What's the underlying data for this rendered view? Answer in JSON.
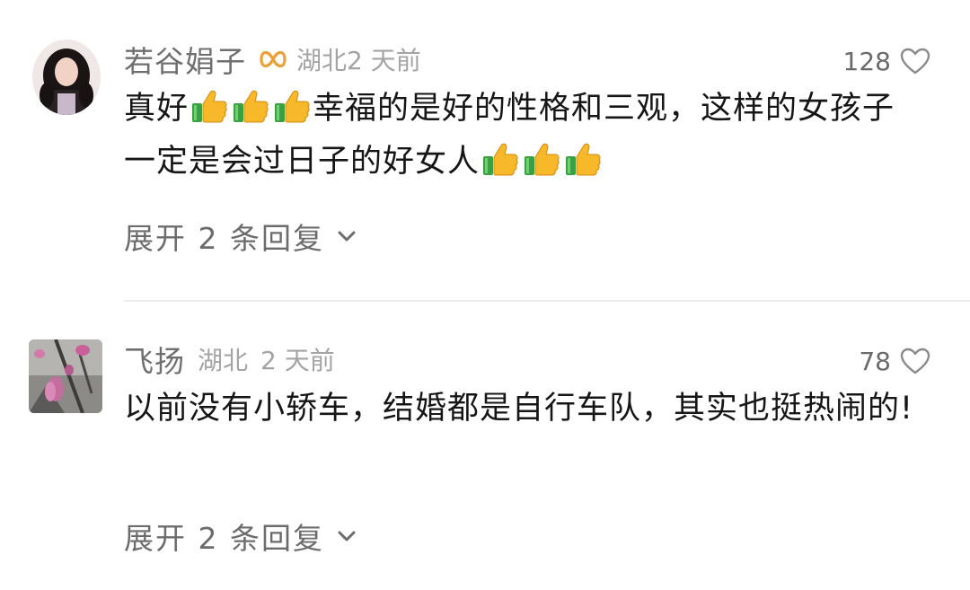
{
  "comments": [
    {
      "username": "若谷娟子",
      "badge_icon": "infinity-badge-icon",
      "badge_color": "#e9a23b",
      "location": "湖北",
      "time": "2 天前",
      "likes": "128",
      "text_parts": [
        "真好",
        "幸福的是好的性格和三观，这样的女孩子一定是会过日子的好女人"
      ],
      "emoji": "thumbs-up-icon",
      "replies_label": "展开 2 条回复"
    },
    {
      "username": "飞扬",
      "location": "湖北",
      "time": "2 天前",
      "likes": "78",
      "text": "以前没有小轿车，结婚都是自行车队，其实也挺热闹的!",
      "replies_label": "展开 2 条回复"
    }
  ],
  "colors": {
    "username": "#6f6f6f",
    "meta": "#a4a4a4",
    "body_text": "#161616",
    "divider": "#ececec"
  }
}
